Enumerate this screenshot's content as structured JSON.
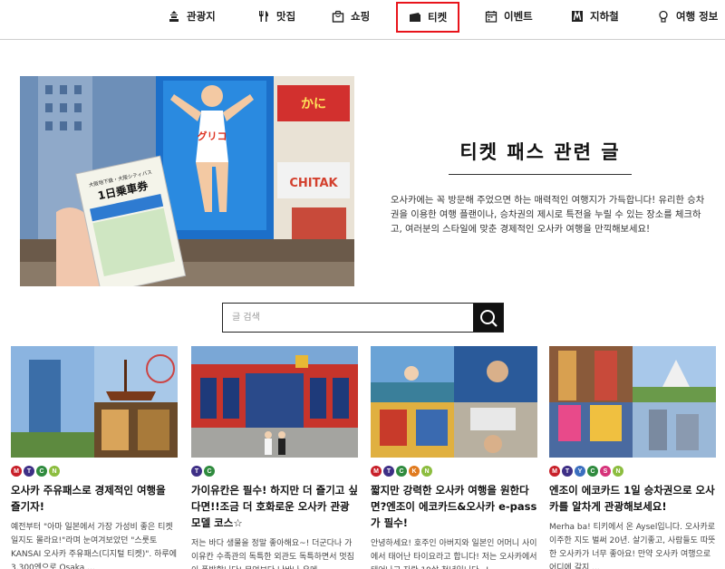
{
  "nav": {
    "items": [
      {
        "label": "관광지",
        "icon": "temple-icon"
      },
      {
        "label": "맛집",
        "icon": "fork-knife-icon"
      },
      {
        "label": "쇼핑",
        "icon": "shopping-bag-icon"
      },
      {
        "label": "티켓",
        "icon": "ticket-icon",
        "active": true
      },
      {
        "label": "이벤트",
        "icon": "calendar-icon"
      },
      {
        "label": "지하철",
        "icon": "subway-icon"
      },
      {
        "label": "여행 정보",
        "icon": "lightbulb-icon"
      }
    ]
  },
  "hero": {
    "title": "티켓 패스 관련 글",
    "description": "오사카에는 꼭 방문해 주었으면 하는 매력적인 여행지가 가득합니다! 유리한 승차권을 이용한 여행 플랜이나, 승차권의 제시로 특전을 누릴 수 있는 장소를 체크하고, 여러분의 스타일에 맞춘 경제적인 오사카 여행을 만끽해보세요!",
    "ticket_text": {
      "top": "大阪地下鉄・大阪シティバス",
      "main": "1日乗車券"
    }
  },
  "search": {
    "placeholder": "글 검색"
  },
  "colors": {
    "accent": "#e8141b",
    "M": "#c8202a",
    "T": "#3e2f86",
    "C": "#2f8b3e",
    "N": "#8cbd3f",
    "K": "#e07a1e",
    "Y": "#3b6fbf",
    "S": "#d6337a"
  },
  "cards": [
    {
      "tags": [
        "M",
        "T",
        "C",
        "N"
      ],
      "title": "오사카 주유패스로 경제적인 여행을 즐기자!",
      "excerpt": "예전부터 \"아마 일본에서 가장 가성비 좋은 티켓일지도 몰라요!\"라며 눈여겨보았던 \"스룻토KANSAI 오사카 주유패스(디지털 티켓)\". 하루에 3,300엔으로 Osaka ..."
    },
    {
      "tags": [
        "T",
        "C"
      ],
      "title": "가이유칸은 필수! 하지만 더 즐기고 싶다면!!조금 더 호화로운 오사카 관광 모델 코스☆",
      "excerpt": "저는 바다 생물을 정말 좋아해요~! 더군다나 가이유칸 수족관의 독특한 외관도 독특하면서 멋짐이 폭발합니다! 무엇보다 난바나 우메"
    },
    {
      "tags": [
        "M",
        "T",
        "C",
        "K",
        "N"
      ],
      "title": "짧지만 강력한 오사카 여행을 원한다면?엔조이 에코카드&오사카 e-pass가 필수!",
      "excerpt": "안녕하세요! 호주인 아버지와 일본인 어머니 사이에서 태어난 타이요라고 합니다! 저는 오사카에서 태어나고 자란 19살 청년입니다~!"
    },
    {
      "tags": [
        "M",
        "T",
        "Y",
        "C",
        "S",
        "N"
      ],
      "title": "엔조이 에코카드 1일 승차권으로 오사카를 알차게 관광해보세요!",
      "excerpt": "Merha ba! 티키에서 온 Aysel입니다. 오사카로 이주한 지도 벌써 20년. 살기좋고, 사람들도 따뜻한 오사카가 너무 좋아요! 만약 오사카 여행으로 어디에 갈지 ..."
    }
  ]
}
